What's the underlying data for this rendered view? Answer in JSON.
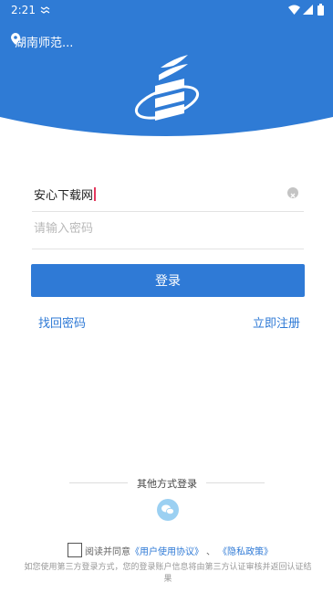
{
  "status_bar": {
    "time": "2:21"
  },
  "header": {
    "location": "湖南师范..."
  },
  "form": {
    "username_value": "安心下载网",
    "password_placeholder": "请输入密码",
    "login_label": "登录",
    "forgot_label": "找回密码",
    "register_label": "立即注册"
  },
  "other_login": {
    "label": "其他方式登录"
  },
  "agreement": {
    "prefix": "阅读并同意",
    "user_agreement": "《用户使用协议》",
    "separator": "、",
    "privacy_policy": "《隐私政策》"
  },
  "notice": "如您使用第三方登录方式，您的登录账户信息将由第三方认证审核并返回认证结果",
  "colors": {
    "primary": "#2f7ad6",
    "header": "#2f7bd5",
    "wechat": "#9bd0f2"
  }
}
